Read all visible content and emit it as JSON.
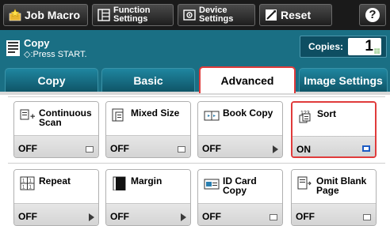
{
  "toolbar": {
    "job_macro": "Job Macro",
    "function_settings": [
      "Function",
      "Settings"
    ],
    "device_settings": [
      "Device",
      "Settings"
    ],
    "reset": "Reset",
    "help": "?"
  },
  "status": {
    "title": "Copy",
    "subtitle": "◇:Press START.",
    "copies_label": "Copies:",
    "copies_value": "1"
  },
  "tabs": [
    {
      "label": "Copy"
    },
    {
      "label": "Basic"
    },
    {
      "label": "Advanced",
      "active": true
    },
    {
      "label": "Image Settings"
    }
  ],
  "functions": [
    {
      "name": [
        "Continuous",
        "Scan"
      ],
      "value": "OFF",
      "indicator": "box",
      "icon": "continuous-scan-icon"
    },
    {
      "name": [
        "Mixed Size"
      ],
      "value": "OFF",
      "indicator": "box",
      "icon": "mixed-size-icon"
    },
    {
      "name": [
        "Book Copy"
      ],
      "value": "OFF",
      "indicator": "arrow",
      "icon": "book-copy-icon"
    },
    {
      "name": [
        "Sort"
      ],
      "value": "ON",
      "indicator": "box-on",
      "icon": "sort-icon",
      "highlighted": true
    },
    {
      "name": [
        "Repeat"
      ],
      "value": "OFF",
      "indicator": "arrow",
      "icon": "repeat-icon"
    },
    {
      "name": [
        "Margin"
      ],
      "value": "OFF",
      "indicator": "arrow",
      "icon": "margin-icon"
    },
    {
      "name": [
        "ID Card",
        "Copy"
      ],
      "value": "OFF",
      "indicator": "box",
      "icon": "id-card-copy-icon"
    },
    {
      "name": [
        "Omit Blank",
        "Page"
      ],
      "value": "OFF",
      "indicator": "box",
      "icon": "omit-blank-page-icon"
    }
  ],
  "colors": {
    "accent_teal": "#1a6f84",
    "highlight_red": "#e03b3b",
    "on_indicator_blue": "#1c5bc4"
  }
}
